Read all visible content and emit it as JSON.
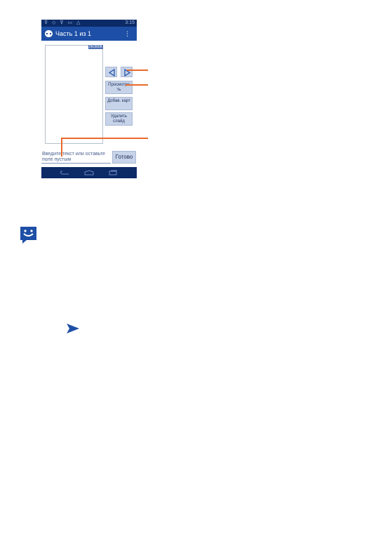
{
  "phone": {
    "status_time": "3:15",
    "app_title": "Часть 1 из 1",
    "slide_counter": "2K/300K",
    "buttons": {
      "preview": "Просмотре ть",
      "add_card": "Добав. карт",
      "delete_slide": "Удалить слайд",
      "done": "Готово"
    },
    "text_input_placeholder": "Введите текст или оставьте поле пустым"
  },
  "colors": {
    "status_bar": "#0b2a66",
    "app_bar": "#1e4fa6",
    "button_fill": "#c6d3e9",
    "callout_orange": "#e8692a",
    "icon_blue": "#1e4fa6"
  },
  "icons": {
    "messaging_app_icon": "smiley-speech-bubble-icon",
    "send_icon": "send-arrow-icon"
  }
}
